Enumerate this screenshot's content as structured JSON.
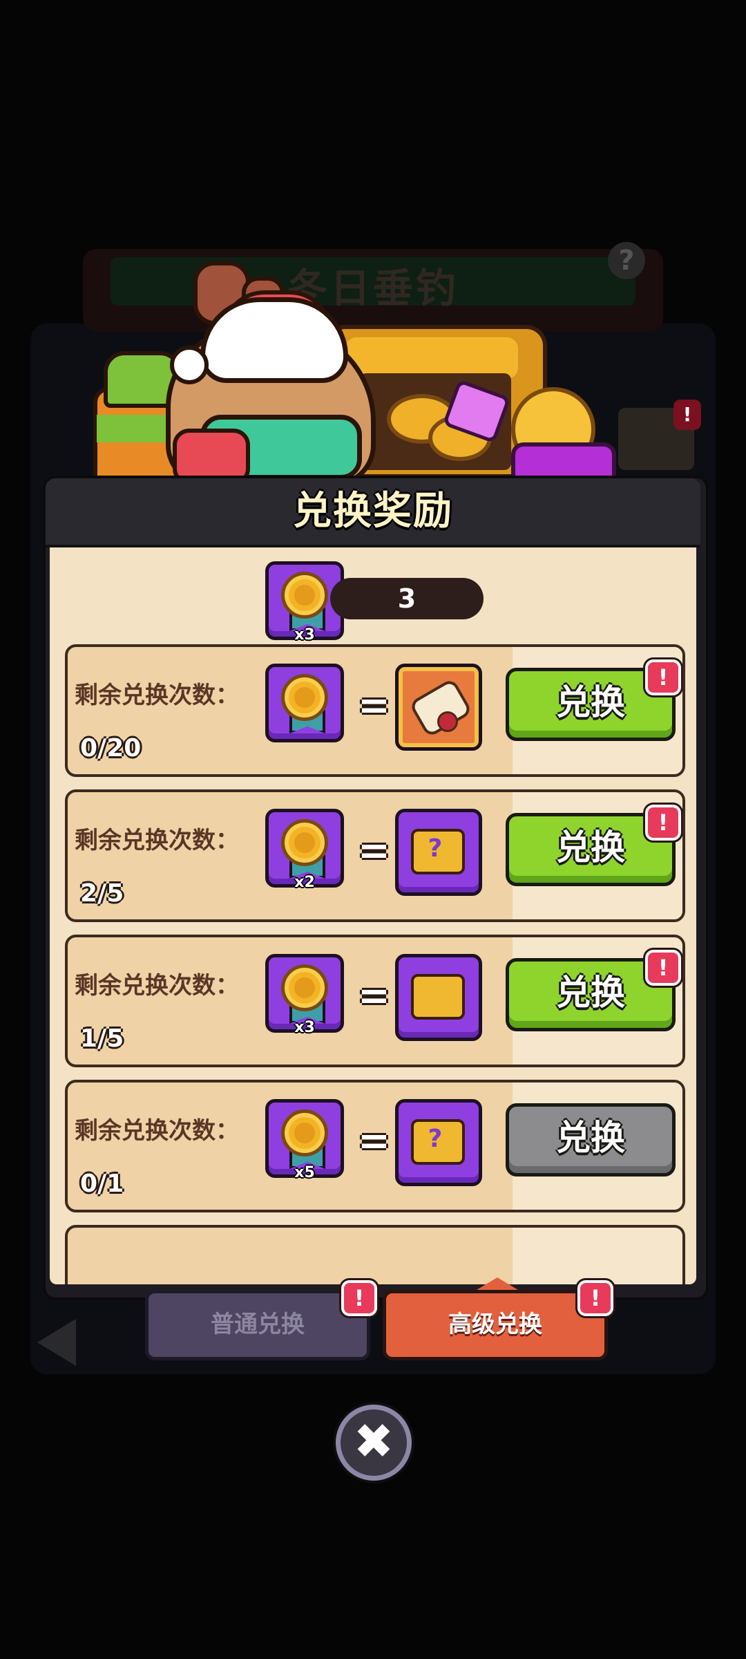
{
  "background": {
    "event_title": "冬日垂钓",
    "help_glyph": "?",
    "book_badge": "!"
  },
  "panel": {
    "title": "兑换奖励",
    "token_multiplier": "x3",
    "token_count": "3"
  },
  "rows": [
    {
      "label": "剩余兑换次数：",
      "count": "0/20",
      "cost_multiplier": "",
      "reward_icon": "scroll-icon",
      "button_label": "兑换",
      "button_state": "active",
      "badge": "!"
    },
    {
      "label": "剩余兑换次数：",
      "count": "2/5",
      "cost_multiplier": "x2",
      "reward_icon": "mystery-chest-icon",
      "button_label": "兑换",
      "button_state": "active",
      "badge": "!"
    },
    {
      "label": "剩余兑换次数：",
      "count": "1/5",
      "cost_multiplier": "x3",
      "reward_icon": "cat-chest-icon",
      "button_label": "兑换",
      "button_state": "active",
      "badge": "!"
    },
    {
      "label": "剩余兑换次数：",
      "count": "0/1",
      "cost_multiplier": "x5",
      "reward_icon": "mystery-skull-chest-icon",
      "button_label": "兑换",
      "button_state": "disabled",
      "badge": ""
    }
  ],
  "tabs": {
    "normal_label": "普通兑换",
    "normal_badge": "!",
    "advanced_label": "高级兑换",
    "advanced_badge": "!"
  },
  "close_glyph": "✖",
  "colors": {
    "accent_green": "#8fd42c",
    "disabled_gray": "#8c8b8e",
    "tab_active": "#e2603e",
    "badge_red": "#e83a5a"
  }
}
